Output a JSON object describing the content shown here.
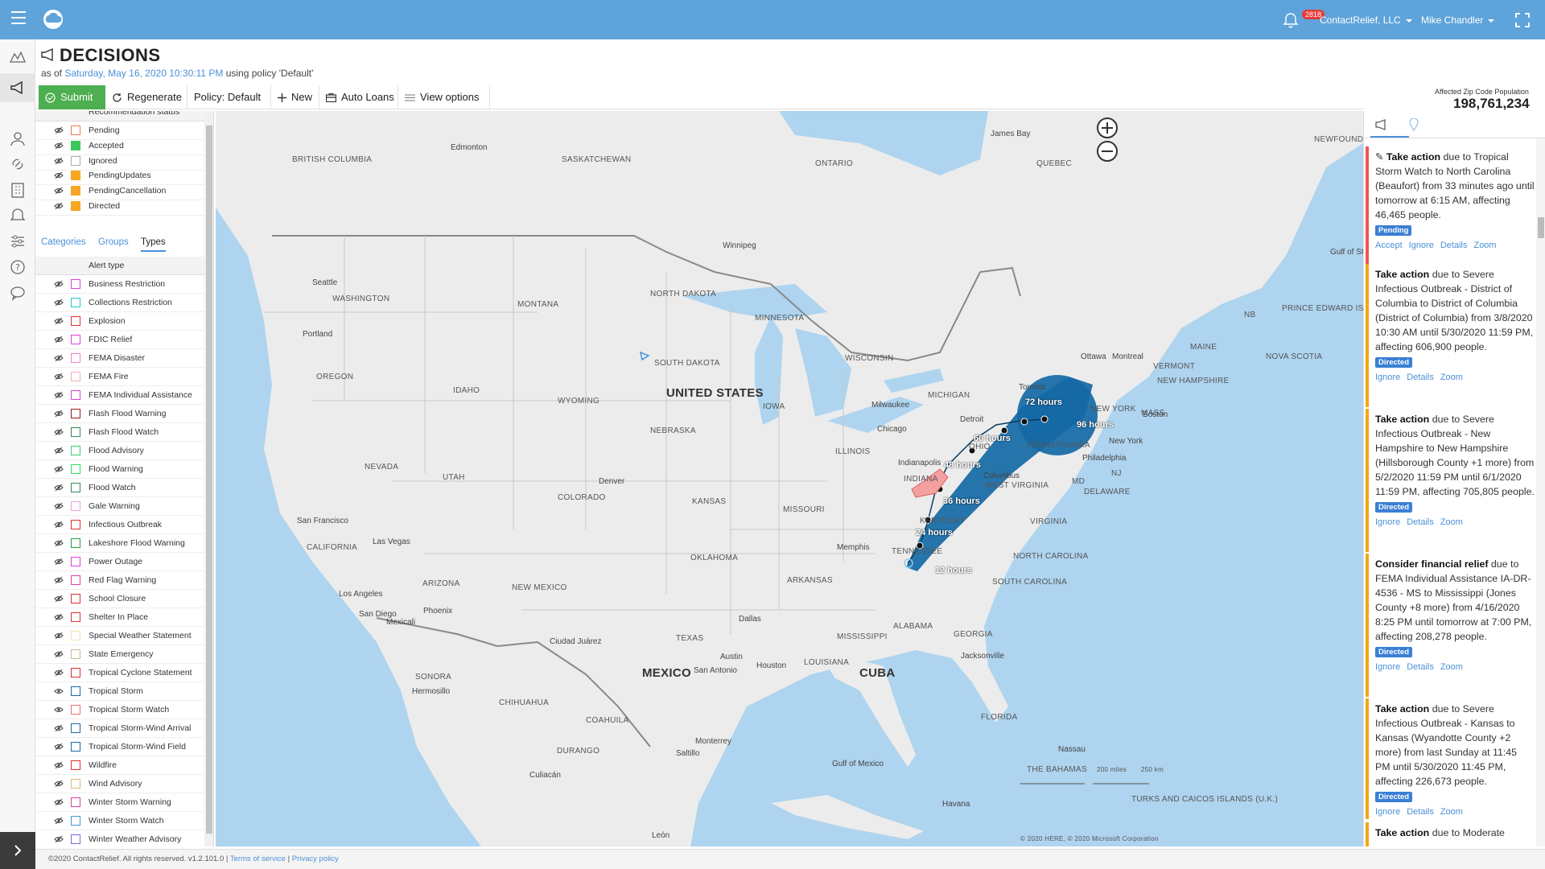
{
  "app": {
    "notification_count": "2818",
    "company": "ContactRelief, LLC",
    "user": "Mike Chandler"
  },
  "header": {
    "title": "DECISIONS",
    "as_of_prefix": "as of",
    "as_of_date": "Saturday, May 16, 2020 10:30:11 PM",
    "policy_text": "using policy 'Default'"
  },
  "toolbar": {
    "submit": "Submit",
    "regenerate": "Regenerate",
    "policy": "Policy: Default",
    "new": "New",
    "auto_loans": "Auto Loans",
    "view_options": "View options",
    "affected_label": "Affected Zip Code Population",
    "affected_value": "198,761,234"
  },
  "legend": {
    "status_header": "Recommendation status",
    "status_items": [
      {
        "label": "Pending",
        "color": "#f07850"
      },
      {
        "label": "Accepted",
        "color": "#3cc85a"
      },
      {
        "label": "Ignored",
        "color": "#ffffff"
      },
      {
        "label": "PendingUpdates",
        "color": "#f5a623"
      },
      {
        "label": "PendingCancellation",
        "color": "#f5a623"
      },
      {
        "label": "Directed",
        "color": "#f5a623"
      }
    ],
    "tabs": [
      "Categories",
      "Groups",
      "Types"
    ],
    "types_header": "Alert type",
    "types": [
      {
        "label": "Business Restriction",
        "color": "#e040e0",
        "fill": false
      },
      {
        "label": "Collections Restriction",
        "color": "#20c8d0",
        "fill": false
      },
      {
        "label": "Explosion",
        "color": "#e03030",
        "fill": false
      },
      {
        "label": "FDIC Relief",
        "color": "#e040e0",
        "fill": false
      },
      {
        "label": "FEMA Disaster",
        "color": "#f080d0",
        "fill": false
      },
      {
        "label": "FEMA Fire",
        "color": "#f0b0b0",
        "fill": false
      },
      {
        "label": "FEMA Individual Assistance",
        "color": "#e040e0",
        "fill": false
      },
      {
        "label": "Flash Flood Warning",
        "color": "#a01818",
        "fill": false
      },
      {
        "label": "Flash Flood Watch",
        "color": "#2e8b57",
        "fill": false
      },
      {
        "label": "Flood Advisory",
        "color": "#3cd070",
        "fill": false
      },
      {
        "label": "Flood Warning",
        "color": "#30e060",
        "fill": false
      },
      {
        "label": "Flood Watch",
        "color": "#2e8b57",
        "fill": false
      },
      {
        "label": "Gale Warning",
        "color": "#f0a0e0",
        "fill": false
      },
      {
        "label": "Infectious Outbreak",
        "color": "#e03030",
        "fill": false
      },
      {
        "label": "Lakeshore Flood Warning",
        "color": "#20a040",
        "fill": false
      },
      {
        "label": "Power Outage",
        "color": "#e040e0",
        "fill": false
      },
      {
        "label": "Red Flag Warning",
        "color": "#e040a0",
        "fill": false
      },
      {
        "label": "School Closure",
        "color": "#e03030",
        "fill": false
      },
      {
        "label": "Shelter In Place",
        "color": "#e03030",
        "fill": false
      },
      {
        "label": "Special Weather Statement",
        "color": "#f5e0b0",
        "fill": false
      },
      {
        "label": "State Emergency",
        "color": "#c8b890",
        "fill": false
      },
      {
        "label": "Tropical Cyclone Statement",
        "color": "#e03030",
        "fill": false
      },
      {
        "label": "Tropical Storm",
        "color": "#1a6aa8",
        "fill": false
      },
      {
        "label": "Tropical Storm Watch",
        "color": "#f07070",
        "fill": false
      },
      {
        "label": "Tropical Storm-Wind Arrival",
        "color": "#1a6aa8",
        "fill": false
      },
      {
        "label": "Tropical Storm-Wind Field",
        "color": "#1a6aa8",
        "fill": false
      },
      {
        "label": "Wildfire",
        "color": "#e03030",
        "fill": false
      },
      {
        "label": "Wind Advisory",
        "color": "#d8c070",
        "fill": false
      },
      {
        "label": "Winter Storm Warning",
        "color": "#e040a0",
        "fill": false
      },
      {
        "label": "Winter Storm Watch",
        "color": "#3aa0d8",
        "fill": false
      },
      {
        "label": "Winter Weather Advisory",
        "color": "#7070e0",
        "fill": false
      }
    ]
  },
  "map": {
    "country_labels": [
      "UNITED STATES",
      "MEXICO",
      "CUBA"
    ],
    "region_labels": [
      "BRITISH COLUMBIA",
      "SASKATCHEWAN",
      "ONTARIO",
      "QUEBEC",
      "NEWFOUNDLAND AND LABRADOR",
      "WASHINGTON",
      "MONTANA",
      "NORTH DAKOTA",
      "MINNESOTA",
      "OREGON",
      "IDAHO",
      "WYOMING",
      "SOUTH DAKOTA",
      "WISCONSIN",
      "MICHIGAN",
      "NEW YORK",
      "VERMONT",
      "NEW HAMPSHIRE",
      "MAINE",
      "MASS",
      "NEVADA",
      "UTAH",
      "COLORADO",
      "NEBRASKA",
      "IOWA",
      "ILLINOIS",
      "INDIANA",
      "OHIO",
      "PENNSYLVANIA",
      "WEST VIRGINIA",
      "VIRGINIA",
      "KANSAS",
      "MISSOURI",
      "KENTUCKY",
      "CALIFORNIA",
      "ARIZONA",
      "NEW MEXICO",
      "OKLAHOMA",
      "ARKANSAS",
      "TENNESSEE",
      "NORTH CAROLINA",
      "SOUTH CAROLINA",
      "TEXAS",
      "MISSISSIPPI",
      "ALABAMA",
      "GEORGIA",
      "LOUISIANA",
      "FLORIDA",
      "SONORA",
      "CHIHUAHUA",
      "COAHUILA",
      "DURANGO",
      "NB",
      "PRINCE EDWARD ISLAND",
      "NOVA SCOTIA",
      "DELAWARE",
      "MD",
      "NJ",
      "THE BAHAMAS",
      "TURKS AND CAICOS ISLANDS (U.K.)"
    ],
    "city_labels": [
      "Edmonton",
      "Winnipeg",
      "Seattle",
      "Portland",
      "Milwaukee",
      "Chicago",
      "Detroit",
      "Toronto",
      "Ottawa",
      "Montreal",
      "Boston",
      "New York",
      "Philadelphia",
      "Indianapolis",
      "Columbus",
      "Denver",
      "San Francisco",
      "Las Vegas",
      "Los Angeles",
      "San Diego",
      "Mexicali",
      "Phoenix",
      "Dallas",
      "Austin",
      "San Antonio",
      "Houston",
      "Memphis",
      "Jacksonville",
      "Ciudad Juárez",
      "Hermosillo",
      "Monterrey",
      "Saltillo",
      "Culiacán",
      "Havana",
      "Nassau",
      "León",
      "James Bay",
      "Gulf of Mexico",
      "Gulf of St. Lawrence"
    ],
    "storm_labels": [
      "12 hours",
      "24 hours",
      "36 hours",
      "48 hours",
      "60 hours",
      "72 hours",
      "96 hours"
    ],
    "scale_labels": [
      "200 miles",
      "250 km"
    ],
    "copyright": "© 2020 HERE, © 2020 Microsoft Corporation"
  },
  "feed": {
    "cards": [
      {
        "verb": "Take action",
        "text": "due to Tropical Storm Watch to North Carolina (Beaufort) from 33 minutes ago until tomorrow at 6:15 AM, affecting 46,465 people.",
        "status": "Pending",
        "actions": [
          "Accept",
          "Ignore",
          "Details",
          "Zoom"
        ],
        "bar": "#e55"
      },
      {
        "verb": "Take action",
        "text": "due to Severe Infectious Outbreak - District of Columbia to District of Columbia (District of Columbia) from 3/8/2020 10:30 AM until 5/30/2020 11:59 PM, affecting 606,900 people.",
        "status": "Directed",
        "actions": [
          "Ignore",
          "Details",
          "Zoom"
        ],
        "bar": "#f3a712"
      },
      {
        "verb": "Take action",
        "text": "due to Severe Infectious Outbreak - New Hampshire to New Hampshire (Hillsborough County +1 more) from 5/2/2020 11:59 PM until 6/1/2020 11:59 PM, affecting 705,805 people.",
        "status": "Directed",
        "actions": [
          "Ignore",
          "Details",
          "Zoom"
        ],
        "bar": "#f3a712"
      },
      {
        "verb": "Consider financial relief",
        "text": "due to FEMA Individual Assistance IA-DR-4536 - MS to Mississippi (Jones County +8 more) from 4/16/2020 8:25 PM until tomorrow at 7:00 PM, affecting 208,278 people.",
        "status": "Directed",
        "actions": [
          "Ignore",
          "Details",
          "Zoom"
        ],
        "bar": "#f3a712"
      },
      {
        "verb": "Take action",
        "text": "due to Severe Infectious Outbreak - Kansas to Kansas (Wyandotte County +2 more) from last Sunday at 11:45 PM until 5/30/2020 11:45 PM, affecting 226,673 people.",
        "status": "Directed",
        "actions": [
          "Ignore",
          "Details",
          "Zoom"
        ],
        "bar": "#f3a712"
      },
      {
        "verb": "Take action",
        "text": "due to Moderate",
        "status": "",
        "actions": [],
        "bar": "#f3a712"
      }
    ]
  },
  "footer": {
    "copyright": "©2020 ContactRelief. All rights reserved. v1.2.101.0 |",
    "terms": "Terms of service",
    "sep": "|",
    "privacy": "Privacy policy"
  }
}
